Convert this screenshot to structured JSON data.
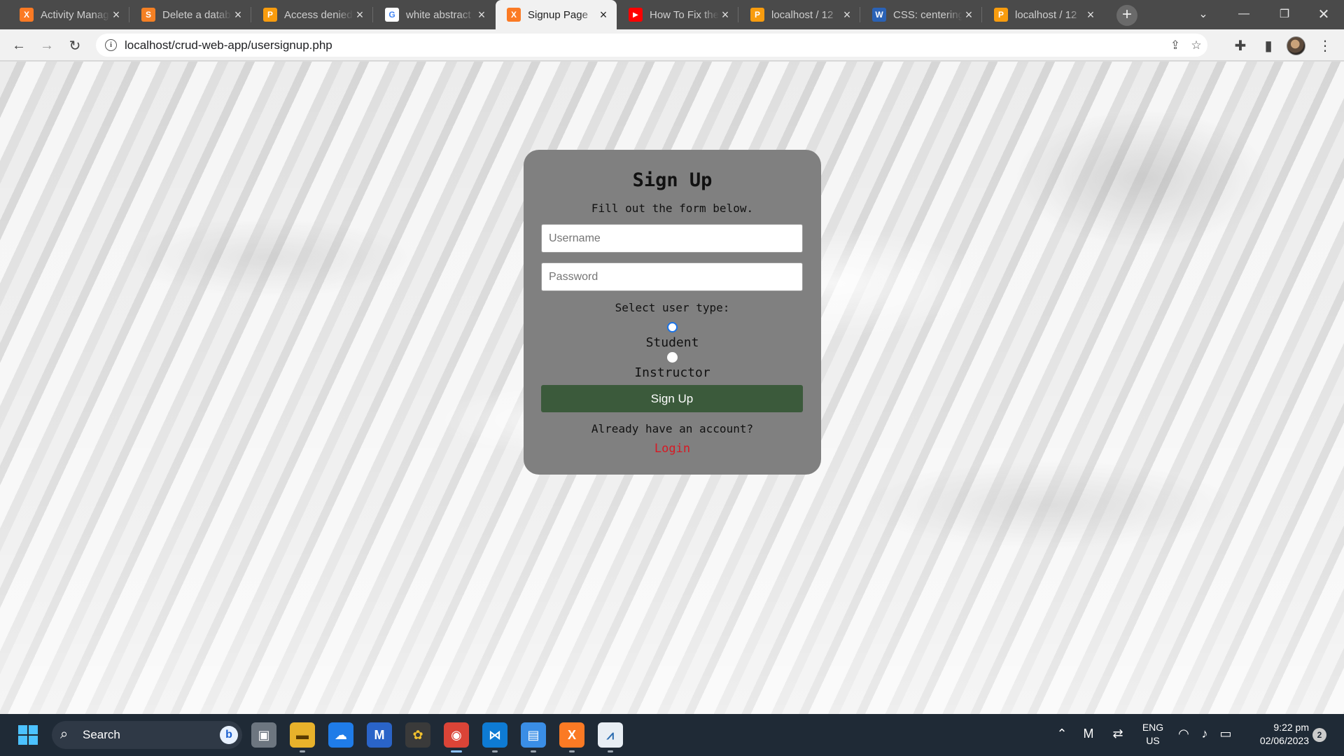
{
  "browser": {
    "tabs": [
      {
        "title": "Activity Manag",
        "favicon": "xampp-icon",
        "color": "#fb7a24",
        "glyph": "X"
      },
      {
        "title": "Delete a datab",
        "favicon": "stackoverflow-icon",
        "color": "#f48024",
        "glyph": "S"
      },
      {
        "title": "Access denied",
        "favicon": "phpmyadmin-icon",
        "color": "#f89c0e",
        "glyph": "P"
      },
      {
        "title": "white abstract",
        "favicon": "google-icon",
        "color": "#4285f4",
        "glyph": "G"
      },
      {
        "title": "Signup Page",
        "favicon": "xampp-icon",
        "color": "#fb7a24",
        "glyph": "X",
        "active": true
      },
      {
        "title": "How To Fix the",
        "favicon": "youtube-icon",
        "color": "#ff0000",
        "glyph": "▶"
      },
      {
        "title": "localhost / 12",
        "favicon": "phpmyadmin-icon",
        "color": "#f89c0e",
        "glyph": "P"
      },
      {
        "title": "CSS: centering",
        "favicon": "w3schools-icon",
        "color": "#2a62b6",
        "glyph": "W"
      },
      {
        "title": "localhost / 12",
        "favicon": "phpmyadmin-icon",
        "color": "#f89c0e",
        "glyph": "P"
      }
    ],
    "url": "localhost/crud-web-app/usersignup.php"
  },
  "form": {
    "title": "Sign Up",
    "subtitle": "Fill out the form below.",
    "username_placeholder": "Username",
    "password_placeholder": "Password",
    "user_type_label": "Select user type:",
    "options": [
      {
        "label": "Student",
        "checked": true
      },
      {
        "label": "Instructor",
        "checked": false
      }
    ],
    "submit_label": "Sign Up",
    "account_prompt": "Already have an account?",
    "login_link": "Login"
  },
  "colors": {
    "card": "#808080",
    "submit": "#3b5a3b",
    "login_link": "#d71923",
    "radio_checked": "#1a73e8"
  },
  "taskbar": {
    "search_label": "Search",
    "language": "ENG",
    "region": "US",
    "time": "9:22 pm",
    "date": "02/06/2023",
    "notification_count": "2"
  }
}
